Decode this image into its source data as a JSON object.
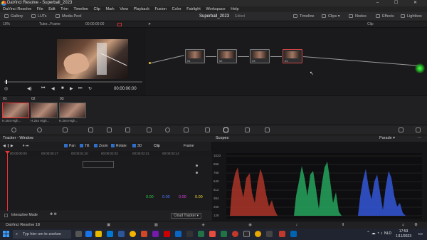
{
  "window": {
    "title": "DaVinci Resolve - Superball_2023",
    "controls": "–  ☐  ✕"
  },
  "menu": [
    "DaVinci Resolve",
    "File",
    "Edit",
    "Trim",
    "Timeline",
    "Clip",
    "Mark",
    "View",
    "Playback",
    "Fusion",
    "Color",
    "Fairlight",
    "Workspace",
    "Help"
  ],
  "toolbar": {
    "gallery": "Gallery",
    "luts": "LUTs",
    "media_pool": "Media Pool",
    "project_title": "Superball_2023",
    "project_status": "Edited",
    "timeline": "Timeline",
    "clips": "Clips",
    "nodes": "Nodes",
    "effects": "Effects",
    "lightbox": "Lightbox"
  },
  "viewer_bar": {
    "zoom": "10%",
    "clip_name": "Tutor...Frame",
    "timecode": "00:00:00:00",
    "mode": "Clip"
  },
  "viewer": {
    "timecode": "00:00:00:00"
  },
  "nodes": [
    {
      "label": "01"
    },
    {
      "label": "02"
    },
    {
      "label": "03"
    },
    {
      "label": "04"
    }
  ],
  "clips": [
    {
      "num": "01",
      "name": "H.264 High..."
    },
    {
      "num": "02",
      "name": "H.264 High..."
    },
    {
      "num": "03",
      "name": "H.264 High..."
    }
  ],
  "tracker": {
    "title": "Tracker - Window",
    "options": [
      "Pan",
      "Tilt",
      "Zoom",
      "Rotate",
      "3D"
    ],
    "mode_clip": "Clip",
    "mode_frame": "Frame",
    "ruler": [
      "00:00:00:00",
      "00:00:00:17",
      "00:00:01:10",
      "00:00:02:03",
      "00:00:02:21",
      "00:00:03:14"
    ],
    "values": [
      {
        "v": "0.00",
        "color": "#2ecc40"
      },
      {
        "v": "0.00",
        "color": "#4a7bff"
      },
      {
        "v": "0.00",
        "color": "#e040e0"
      },
      {
        "v": "0.00",
        "color": "#e6d23a"
      }
    ],
    "interactive_mode": "Interactive Mode",
    "cloud_tracker": "Cloud Tracker"
  },
  "scopes": {
    "title": "Scopes",
    "mode": "Parade",
    "scale": [
      "1023",
      "896",
      "768",
      "640",
      "512",
      "384",
      "256",
      "128"
    ]
  },
  "status": {
    "app": "DaVinci Resolve 18"
  },
  "taskbar": {
    "search_placeholder": "Typ hier om te zoeken",
    "lang": "NLD",
    "time": "17:53",
    "date": "1/11/2023"
  }
}
